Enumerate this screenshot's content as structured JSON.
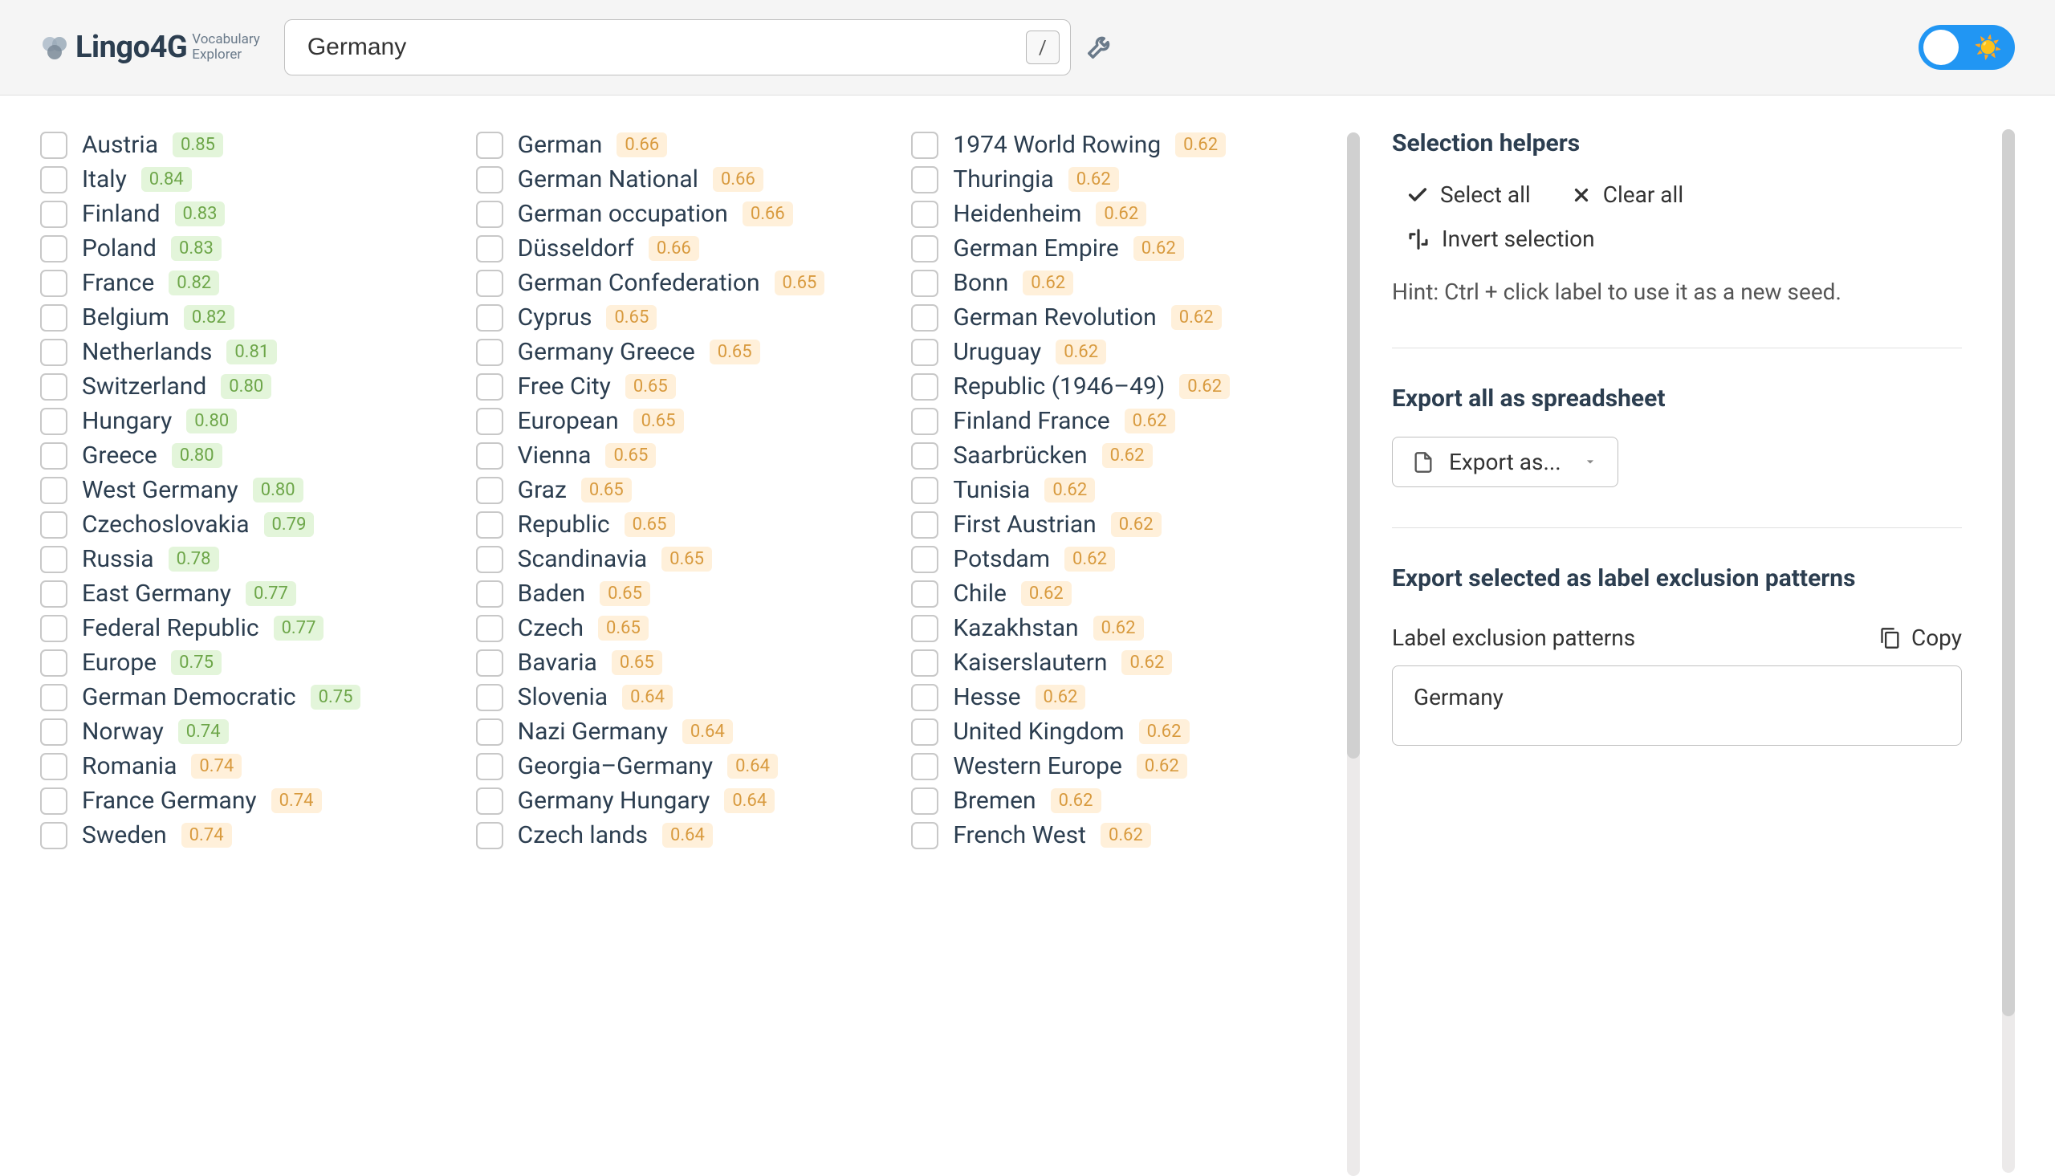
{
  "app": {
    "name": "Lingo4G",
    "sub1": "Vocabulary",
    "sub2": "Explorer"
  },
  "search": {
    "value": "Germany",
    "kbd": "/"
  },
  "columns": [
    [
      {
        "label": "Austria",
        "score": "0.85",
        "c": "green"
      },
      {
        "label": "Italy",
        "score": "0.84",
        "c": "green"
      },
      {
        "label": "Finland",
        "score": "0.83",
        "c": "green"
      },
      {
        "label": "Poland",
        "score": "0.83",
        "c": "green"
      },
      {
        "label": "France",
        "score": "0.82",
        "c": "green"
      },
      {
        "label": "Belgium",
        "score": "0.82",
        "c": "green"
      },
      {
        "label": "Netherlands",
        "score": "0.81",
        "c": "green"
      },
      {
        "label": "Switzerland",
        "score": "0.80",
        "c": "green"
      },
      {
        "label": "Hungary",
        "score": "0.80",
        "c": "green"
      },
      {
        "label": "Greece",
        "score": "0.80",
        "c": "green"
      },
      {
        "label": "West Germany",
        "score": "0.80",
        "c": "green"
      },
      {
        "label": "Czechoslovakia",
        "score": "0.79",
        "c": "green"
      },
      {
        "label": "Russia",
        "score": "0.78",
        "c": "green"
      },
      {
        "label": "East Germany",
        "score": "0.77",
        "c": "green"
      },
      {
        "label": "Federal Republic",
        "score": "0.77",
        "c": "green"
      },
      {
        "label": "Europe",
        "score": "0.75",
        "c": "green"
      },
      {
        "label": "German Democratic",
        "score": "0.75",
        "c": "green"
      },
      {
        "label": "Norway",
        "score": "0.74",
        "c": "green"
      },
      {
        "label": "Romania",
        "score": "0.74",
        "c": "yel"
      },
      {
        "label": "France Germany",
        "score": "0.74",
        "c": "yel"
      },
      {
        "label": "Sweden",
        "score": "0.74",
        "c": "yel"
      }
    ],
    [
      {
        "label": "German",
        "score": "0.66",
        "c": "yel"
      },
      {
        "label": "German National",
        "score": "0.66",
        "c": "yel"
      },
      {
        "label": "German occupation",
        "score": "0.66",
        "c": "yel"
      },
      {
        "label": "Düsseldorf",
        "score": "0.66",
        "c": "yel"
      },
      {
        "label": "German Confederation",
        "score": "0.65",
        "c": "yel"
      },
      {
        "label": "Cyprus",
        "score": "0.65",
        "c": "yel"
      },
      {
        "label": "Germany Greece",
        "score": "0.65",
        "c": "yel"
      },
      {
        "label": "Free City",
        "score": "0.65",
        "c": "yel"
      },
      {
        "label": "European",
        "score": "0.65",
        "c": "yel"
      },
      {
        "label": "Vienna",
        "score": "0.65",
        "c": "yel"
      },
      {
        "label": "Graz",
        "score": "0.65",
        "c": "yel"
      },
      {
        "label": "Republic",
        "score": "0.65",
        "c": "yel"
      },
      {
        "label": "Scandinavia",
        "score": "0.65",
        "c": "yel"
      },
      {
        "label": "Baden",
        "score": "0.65",
        "c": "yel"
      },
      {
        "label": "Czech",
        "score": "0.65",
        "c": "yel"
      },
      {
        "label": "Bavaria",
        "score": "0.65",
        "c": "yel"
      },
      {
        "label": "Slovenia",
        "score": "0.64",
        "c": "yel"
      },
      {
        "label": "Nazi Germany",
        "score": "0.64",
        "c": "yel"
      },
      {
        "label": "Georgia–Germany",
        "score": "0.64",
        "c": "yel"
      },
      {
        "label": "Germany Hungary",
        "score": "0.64",
        "c": "yel"
      },
      {
        "label": "Czech lands",
        "score": "0.64",
        "c": "yel"
      }
    ],
    [
      {
        "label": "1974 World Rowing",
        "score": "0.62",
        "c": "yel"
      },
      {
        "label": "Thuringia",
        "score": "0.62",
        "c": "yel"
      },
      {
        "label": "Heidenheim",
        "score": "0.62",
        "c": "yel"
      },
      {
        "label": "German Empire",
        "score": "0.62",
        "c": "yel"
      },
      {
        "label": "Bonn",
        "score": "0.62",
        "c": "yel"
      },
      {
        "label": "German Revolution",
        "score": "0.62",
        "c": "yel"
      },
      {
        "label": "Uruguay",
        "score": "0.62",
        "c": "yel"
      },
      {
        "label": "Republic (1946–49)",
        "score": "0.62",
        "c": "yel"
      },
      {
        "label": "Finland France",
        "score": "0.62",
        "c": "yel"
      },
      {
        "label": "Saarbrücken",
        "score": "0.62",
        "c": "yel"
      },
      {
        "label": "Tunisia",
        "score": "0.62",
        "c": "yel"
      },
      {
        "label": "First Austrian",
        "score": "0.62",
        "c": "yel"
      },
      {
        "label": "Potsdam",
        "score": "0.62",
        "c": "yel"
      },
      {
        "label": "Chile",
        "score": "0.62",
        "c": "yel"
      },
      {
        "label": "Kazakhstan",
        "score": "0.62",
        "c": "yel"
      },
      {
        "label": "Kaiserslautern",
        "score": "0.62",
        "c": "yel"
      },
      {
        "label": "Hesse",
        "score": "0.62",
        "c": "yel"
      },
      {
        "label": "United Kingdom",
        "score": "0.62",
        "c": "yel"
      },
      {
        "label": "Western Europe",
        "score": "0.62",
        "c": "yel"
      },
      {
        "label": "Bremen",
        "score": "0.62",
        "c": "yel"
      },
      {
        "label": "French West",
        "score": "0.62",
        "c": "yel"
      }
    ]
  ],
  "sidebar": {
    "helpers_title": "Selection helpers",
    "select_all": "Select all",
    "clear_all": "Clear all",
    "invert": "Invert selection",
    "hint": "Hint: Ctrl + click label to use it as a new seed.",
    "export_title": "Export all as spreadsheet",
    "export_btn": "Export as...",
    "excl_title": "Export selected as label exclusion patterns",
    "excl_label": "Label exclusion patterns",
    "copy": "Copy",
    "excl_value": "Germany"
  }
}
